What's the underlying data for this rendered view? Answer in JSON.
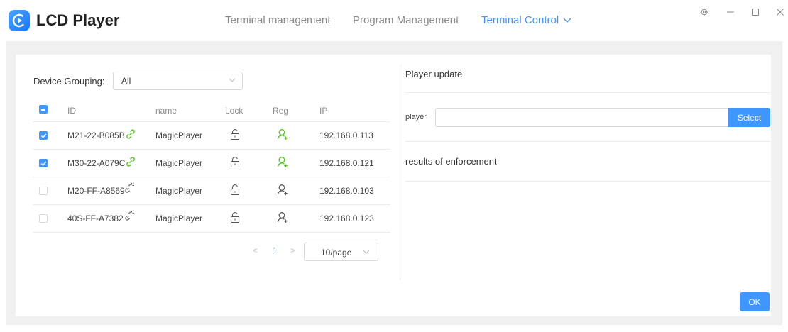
{
  "app": {
    "title": "LCD Player"
  },
  "nav": {
    "items": [
      {
        "label": "Terminal management"
      },
      {
        "label": "Program Management"
      },
      {
        "label": "Terminal Control"
      }
    ]
  },
  "filter": {
    "label": "Device Grouping:",
    "value": "All"
  },
  "table": {
    "columns": [
      "ID",
      "name",
      "Lock",
      "Reg",
      "IP"
    ],
    "rows": [
      {
        "id": "M21-22-B085B",
        "name": "MagicPlayer",
        "ip": "192.168.0.113",
        "checked": true,
        "connected": true,
        "registered": true
      },
      {
        "id": "M30-22-A079C",
        "name": "MagicPlayer",
        "ip": "192.168.0.121",
        "checked": true,
        "connected": true,
        "registered": true
      },
      {
        "id": "M20-FF-A8569",
        "name": "MagicPlayer",
        "ip": "192.168.0.103",
        "checked": false,
        "connected": false,
        "registered": false
      },
      {
        "id": "40S-FF-A7382",
        "name": "MagicPlayer",
        "ip": "192.168.0.123",
        "checked": false,
        "connected": false,
        "registered": false
      }
    ]
  },
  "pagination": {
    "prev": "<",
    "current": "1",
    "next": ">",
    "page_size": "10/page"
  },
  "update": {
    "title": "Player update",
    "player_label": "player",
    "player_value": "",
    "select_label": "Select",
    "results_label": "results of enforcement",
    "ok_label": "OK"
  },
  "colors": {
    "accent": "#4096ff",
    "connected": "#52c41a",
    "muted": "#8c8c8c",
    "background": "#f0f0f0"
  },
  "icons": [
    "app-logo-icon",
    "chevron-down-icon",
    "settings-icon",
    "minimize-icon",
    "maximize-icon",
    "close-icon",
    "link-icon",
    "unlink-icon",
    "unlock-icon",
    "user-add-icon"
  ]
}
